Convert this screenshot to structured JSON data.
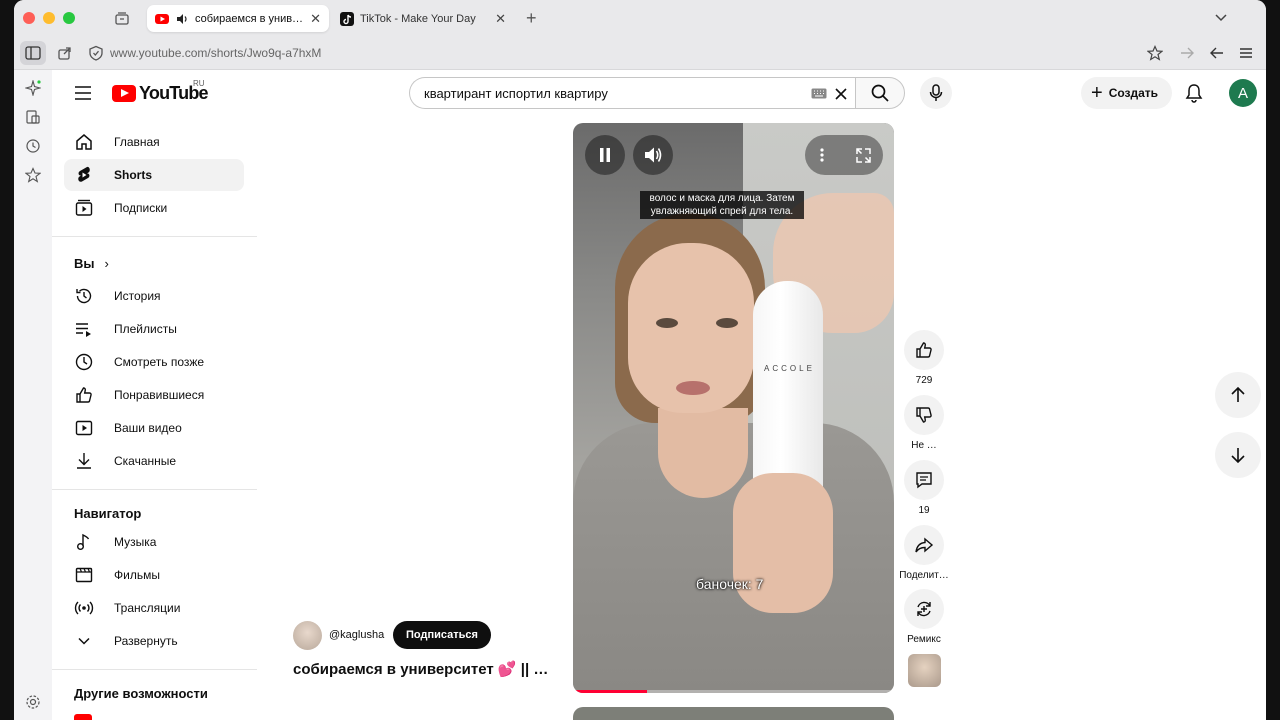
{
  "browser": {
    "tabs": [
      {
        "title": "собираемся в университет",
        "active": true
      },
      {
        "title": "TikTok - Make Your Day",
        "active": false
      }
    ],
    "url": "www.youtube.com/shorts/Jwo9q-a7hxM"
  },
  "header": {
    "logo_text": "YouTube",
    "logo_region": "RU",
    "search_value": "квартирант испортил квартиру",
    "create_label": "Создать",
    "avatar_letter": "A"
  },
  "guide": {
    "main": [
      {
        "label": "Главная",
        "icon": "home-icon"
      },
      {
        "label": "Shorts",
        "icon": "shorts-icon",
        "selected": true
      },
      {
        "label": "Подписки",
        "icon": "subscriptions-icon"
      }
    ],
    "you_heading": "Вы",
    "you": [
      {
        "label": "История",
        "icon": "history-icon"
      },
      {
        "label": "Плейлисты",
        "icon": "playlists-icon"
      },
      {
        "label": "Смотреть позже",
        "icon": "watch-later-icon"
      },
      {
        "label": "Понравившиеся",
        "icon": "liked-icon"
      },
      {
        "label": "Ваши видео",
        "icon": "your-videos-icon"
      },
      {
        "label": "Скачанные",
        "icon": "downloads-icon"
      }
    ],
    "nav_heading": "Навигатор",
    "nav": [
      {
        "label": "Музыка",
        "icon": "music-icon"
      },
      {
        "label": "Фильмы",
        "icon": "movies-icon"
      },
      {
        "label": "Трансляции",
        "icon": "live-icon"
      },
      {
        "label": "Развернуть",
        "icon": "chevron-down-icon"
      }
    ],
    "more_heading": "Другие возможности"
  },
  "video": {
    "caption": "волос и маска для лица. Затем увлажняющий спрей для тела.",
    "subtitle": "баночек: 7",
    "brand": "ACCOLE",
    "progress_fraction": 0.23,
    "channel": "@kaglusha",
    "subscribe_label": "Подписаться",
    "title": "собираемся в университет 💕 || …"
  },
  "actions": {
    "likes": "729",
    "dislike": "Не …",
    "comments": "19",
    "share": "Поделит…",
    "remix": "Ремикс"
  },
  "colors": {
    "accent": "#ff0000",
    "progress": "#ff0033",
    "avatar": "#1e7a4f"
  }
}
